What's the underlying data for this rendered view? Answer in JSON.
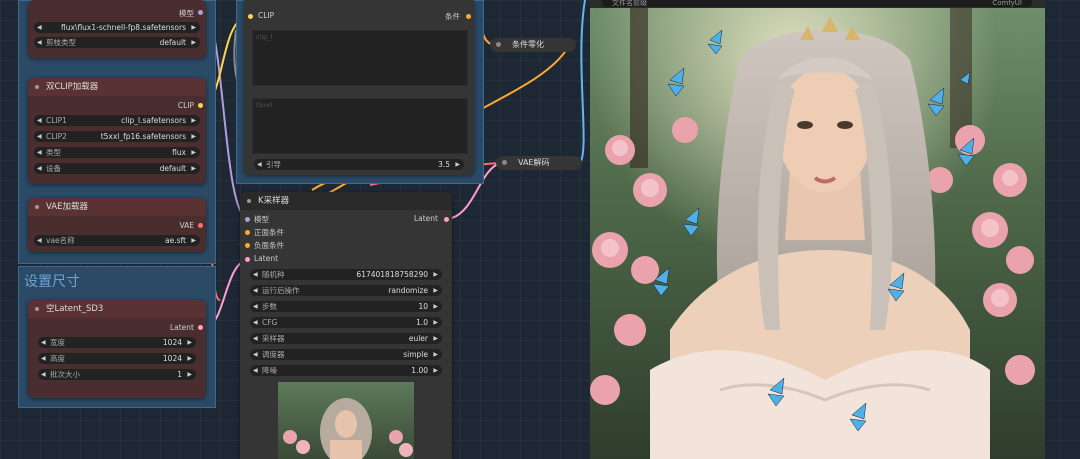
{
  "groups": {
    "set_size": "设置尺寸"
  },
  "nodes": {
    "unet_loader": {
      "output": "模型",
      "widgets": [
        {
          "label": "",
          "value": "flux\\flux1-schnell-fp8.safetensors"
        },
        {
          "label": "剪枝类型",
          "value": "default"
        }
      ]
    },
    "dual_clip": {
      "title": "双CLIP加载器",
      "output": "CLIP",
      "widgets": [
        {
          "label": "CLIP1",
          "value": "clip_l.safetensors"
        },
        {
          "label": "CLIP2",
          "value": "t5xxl_fp16.safetensors"
        },
        {
          "label": "类型",
          "value": "flux"
        },
        {
          "label": "设备",
          "value": "default"
        }
      ]
    },
    "vae_loader": {
      "title": "VAE加载器",
      "output": "VAE",
      "widgets": [
        {
          "label": "vae名称",
          "value": "ae.sft"
        }
      ]
    },
    "empty_latent": {
      "title": "空Latent_SD3",
      "output": "Latent",
      "widgets": [
        {
          "label": "宽度",
          "value": "1024"
        },
        {
          "label": "高度",
          "value": "1024"
        },
        {
          "label": "批次大小",
          "value": "1"
        }
      ]
    },
    "clip_text": {
      "input": "CLIP",
      "output": "条件",
      "textarea1": "clip_l",
      "textarea2": "t5xxl",
      "guidance": {
        "label": "引导",
        "value": "3.5"
      }
    },
    "cond_zero": {
      "title": "条件零化"
    },
    "vae_decode": {
      "title": "VAE解码"
    },
    "ksampler": {
      "title": "K采样器",
      "inputs": [
        "模型",
        "正面条件",
        "负面条件",
        "Latent"
      ],
      "output": "Latent",
      "widgets": [
        {
          "label": "随机种",
          "value": "617401818758290"
        },
        {
          "label": "运行后操作",
          "value": "randomize"
        },
        {
          "label": "步数",
          "value": "10"
        },
        {
          "label": "CFG",
          "value": "1.0"
        },
        {
          "label": "采样器",
          "value": "euler"
        },
        {
          "label": "调度器",
          "value": "simple"
        },
        {
          "label": "降噪",
          "value": "1.00"
        }
      ]
    }
  },
  "preview": {
    "header_left": "文件名前缀",
    "header_right": "ComfyUI"
  },
  "colors": {
    "model_link": "#b39ddb",
    "clip_link": "#ffd54f",
    "vae_link": "#ff6e6e",
    "latent_link": "#ff9ecf",
    "cond_link": "#ffa931"
  }
}
